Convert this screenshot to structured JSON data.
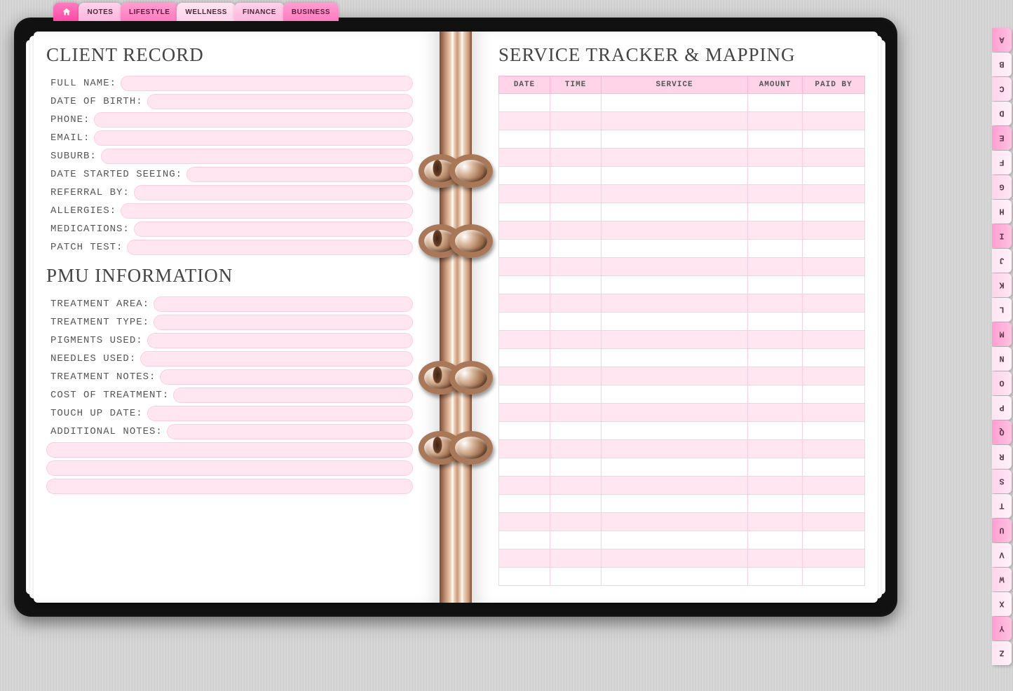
{
  "tabs": {
    "items": [
      {
        "key": "home",
        "label": ""
      },
      {
        "key": "notes",
        "label": "NOTES"
      },
      {
        "key": "lifestyle",
        "label": "LIFESTYLE"
      },
      {
        "key": "wellness",
        "label": "WELLNESS"
      },
      {
        "key": "finance",
        "label": "FINANCE"
      },
      {
        "key": "business",
        "label": "BUSINESS"
      }
    ]
  },
  "left_page": {
    "section1_title": "CLIENT RECORD",
    "fields1": [
      {
        "label": "FULL NAME:"
      },
      {
        "label": "DATE OF BIRTH:"
      },
      {
        "label": "PHONE:"
      },
      {
        "label": "EMAIL:"
      },
      {
        "label": "SUBURB:"
      },
      {
        "label": "DATE STARTED SEEING:"
      },
      {
        "label": "REFERRAL BY:"
      },
      {
        "label": "ALLERGIES:"
      },
      {
        "label": "MEDICATIONS:"
      },
      {
        "label": "PATCH TEST:"
      }
    ],
    "section2_title": "PMU INFORMATION",
    "fields2": [
      {
        "label": "TREATMENT AREA:"
      },
      {
        "label": "TREATMENT TYPE:"
      },
      {
        "label": "PIGMENTS USED:"
      },
      {
        "label": "NEEDLES USED:"
      },
      {
        "label": "TREATMENT NOTES:"
      },
      {
        "label": "COST OF TREATMENT:"
      },
      {
        "label": "TOUCH UP DATE:"
      },
      {
        "label": "ADDITIONAL NOTES:"
      }
    ],
    "extra_line_count": 3
  },
  "right_page": {
    "title": "SERVICE TRACKER & MAPPING",
    "columns": [
      "DATE",
      "TIME",
      "SERVICE",
      "AMOUNT",
      "PAID BY"
    ],
    "row_count": 27
  },
  "alpha_tabs": [
    "A",
    "B",
    "C",
    "D",
    "E",
    "F",
    "G",
    "H",
    "I",
    "J",
    "K",
    "L",
    "M",
    "N",
    "O",
    "P",
    "Q",
    "R",
    "S",
    "T",
    "U",
    "V",
    "W",
    "X",
    "Y",
    "Z"
  ]
}
